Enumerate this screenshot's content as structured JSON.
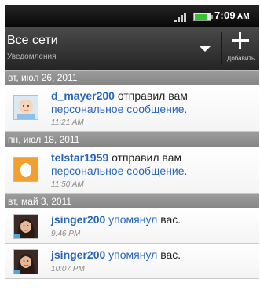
{
  "status_bar": {
    "time": "7:09",
    "time_suffix": "AM",
    "icons": [
      "signal-icon",
      "battery-icon"
    ]
  },
  "header": {
    "title": "Все сети",
    "subtitle": "Уведомления",
    "add_label": "Добавить",
    "icons": [
      "chevron-down-icon",
      "plus-icon"
    ]
  },
  "groups": [
    {
      "date": "вт, июл 26, 2011",
      "items": [
        {
          "user": "d_mayer200",
          "verb": "отправил вам",
          "link": "персональное сообщение.",
          "time": "11:21 AM",
          "avatar": "baby-photo-avatar"
        }
      ]
    },
    {
      "date": "пн, июл 18, 2011",
      "items": [
        {
          "user": "telstar1959",
          "verb": "отправил вам",
          "link": "персональное сообщение.",
          "time": "11:50 AM",
          "avatar": "egg-default-avatar"
        }
      ]
    },
    {
      "date": "вт, май 3, 2011",
      "items": [
        {
          "user": "jsinger200",
          "link": "упомянул",
          "verb": "вас.",
          "time": "9:46 PM",
          "avatar": "woman-photo-avatar"
        },
        {
          "user": "jsinger200",
          "link": "упомянул",
          "verb": "вас.",
          "time": "10:07 PM",
          "avatar": "woman-photo-avatar"
        }
      ]
    }
  ],
  "colors": {
    "link_blue": "#2a66b8",
    "header_gray": "#8e8e8e",
    "title_bar": "#353535",
    "egg_orange": "#f0a030"
  }
}
